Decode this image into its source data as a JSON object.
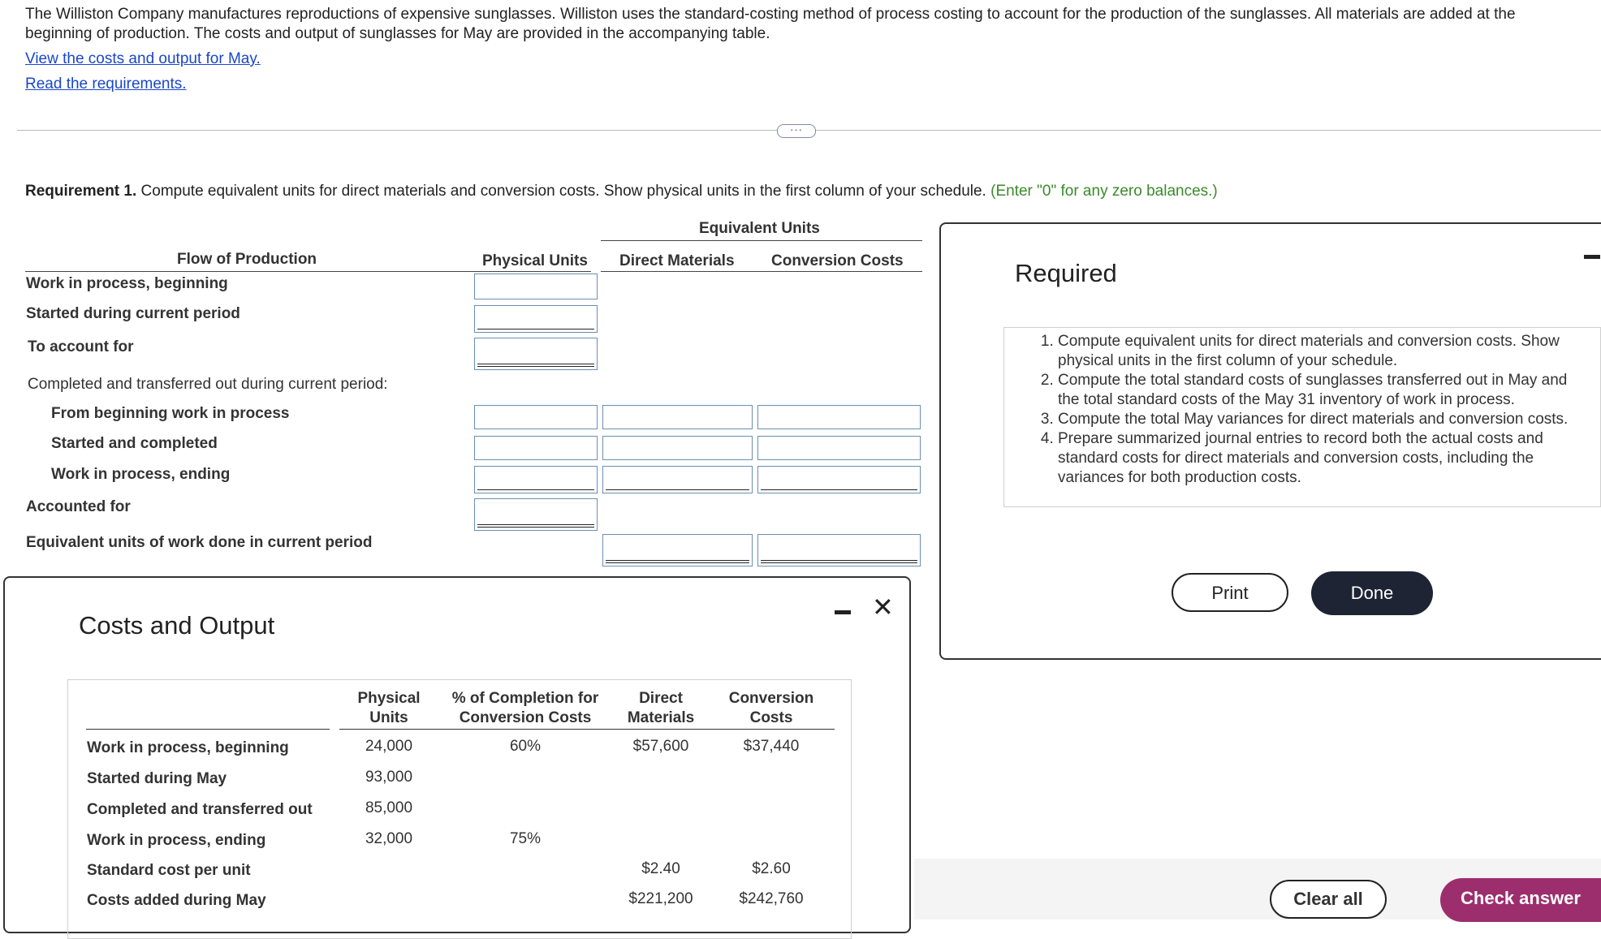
{
  "intro": {
    "paragraph": "The Williston Company manufactures reproductions of expensive sunglasses. Williston uses the standard-costing method of process costing to account for the production of the sunglasses. All materials are added at the beginning of production. The costs and output of sunglasses for May are provided in the accompanying table.",
    "link_costs": "View the costs and output for May.",
    "link_requirements": "Read the requirements."
  },
  "more_button": "···",
  "requirement1": {
    "label": "Requirement 1.",
    "text": " Compute equivalent units for direct materials and conversion costs. Show physical units in the first column of your schedule. ",
    "hint": "(Enter \"0\" for any zero balances.)"
  },
  "schedule": {
    "group_header": "Equivalent Units",
    "col_flow": "Flow of Production",
    "col_physical": "Physical Units",
    "col_dm": "Direct Materials",
    "col_cc": "Conversion Costs",
    "rows": {
      "wip_begin": "Work in process, beginning",
      "started": "Started during current period",
      "to_account": "To account for",
      "completed_hdr": "Completed and transferred out during current period:",
      "from_begin": "From beginning work in process",
      "started_completed": "Started and completed",
      "wip_end": "Work in process, ending",
      "accounted": "Accounted for",
      "eq_units": "Equivalent units of work done in current period"
    }
  },
  "costs_modal": {
    "title": "Costs and Output",
    "headers": {
      "physical": "Physical\nUnits",
      "pct": "% of Completion for\nConversion Costs",
      "dm": "Direct\nMaterials",
      "cc": "Conversion\nCosts"
    },
    "rows": [
      {
        "label": "Work in process, beginning",
        "physical": "24,000",
        "pct": "60%",
        "dm": "$57,600",
        "cc": "$37,440"
      },
      {
        "label": "Started during May",
        "physical": "93,000",
        "pct": "",
        "dm": "",
        "cc": ""
      },
      {
        "label": "Completed and transferred out",
        "physical": "85,000",
        "pct": "",
        "dm": "",
        "cc": ""
      },
      {
        "label": "Work in process, ending",
        "physical": "32,000",
        "pct": "75%",
        "dm": "",
        "cc": ""
      },
      {
        "label": "Standard cost per unit",
        "physical": "",
        "pct": "",
        "dm": "$2.40",
        "cc": "$2.60"
      },
      {
        "label": "Costs added during May",
        "physical": "",
        "pct": "",
        "dm": "$221,200",
        "cc": "$242,760"
      }
    ]
  },
  "required_modal": {
    "title": "Required",
    "items": [
      "Compute equivalent units for direct materials and conversion costs. Show physical units in the first column of your schedule.",
      "Compute the total standard costs of sunglasses transferred out in May and the total standard costs of the May 31 inventory of work in process.",
      "Compute the total May variances for direct materials and conversion costs.",
      "Prepare summarized journal entries to record both the actual costs and standard costs for direct materials and conversion costs, including the variances for both production costs."
    ],
    "print_label": "Print",
    "done_label": "Done"
  },
  "footer": {
    "clear_label": "Clear all",
    "check_label": "Check answer"
  },
  "colors": {
    "link": "#1a47c9",
    "hint_green": "#3a8a2a",
    "done_bg": "#1e2433",
    "check_bg": "#9c2e6e",
    "input_border": "#6a8fb0"
  }
}
